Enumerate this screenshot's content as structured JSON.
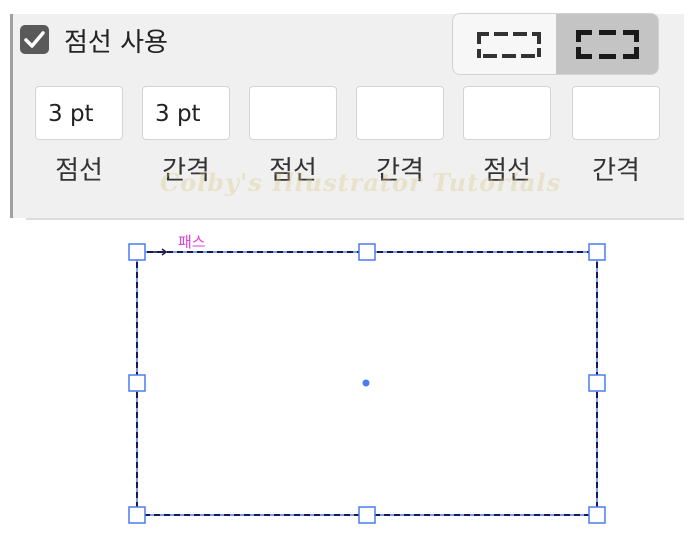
{
  "dashed_line_panel": {
    "checkbox": {
      "label": "점선 사용",
      "checked": true
    },
    "alignment_buttons": [
      {
        "name": "preserve-dash-length",
        "selected": false
      },
      {
        "name": "align-dashes-to-corners",
        "selected": true
      }
    ],
    "fields": [
      {
        "value": "3 pt",
        "label": "점선"
      },
      {
        "value": "3 pt",
        "label": "간격"
      },
      {
        "value": "",
        "label": "점선"
      },
      {
        "value": "",
        "label": "간격"
      },
      {
        "value": "",
        "label": "점선"
      },
      {
        "value": "",
        "label": "간격"
      }
    ],
    "watermark": "Colby's Illustrator Tutorials"
  },
  "canvas": {
    "path_label": "패스",
    "colors": {
      "selection": "#4a7cf0",
      "path_label": "#e33fd8",
      "dash_stroke": "#1a1a4a"
    }
  }
}
